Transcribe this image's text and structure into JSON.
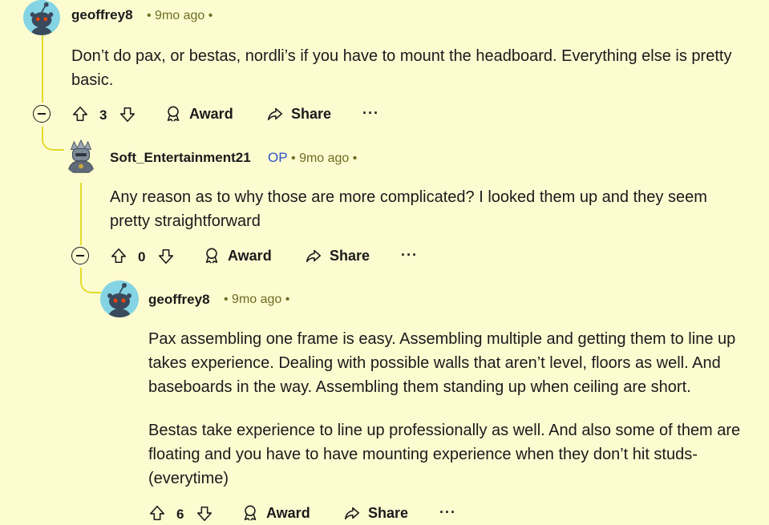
{
  "comments": [
    {
      "author": "geoffrey8",
      "op_badge": "",
      "time": "• 9mo ago •",
      "avatar": "snoo-avatar-icon",
      "paragraphs": [
        "Don’t do pax, or bestas, nordli’s if you have to mount the headboard. Everything else is pretty basic."
      ],
      "votes": "3",
      "award_label": "Award",
      "share_label": "Share",
      "more_label": "···"
    },
    {
      "author": "Soft_Entertainment21",
      "op_badge": "OP",
      "time": "• 9mo ago •",
      "avatar": "robot-avatar-icon",
      "paragraphs": [
        "Any reason as to why those are more complicated? I looked them up and they seem pretty straightforward"
      ],
      "votes": "0",
      "award_label": "Award",
      "share_label": "Share",
      "more_label": "···"
    },
    {
      "author": "geoffrey8",
      "op_badge": "",
      "time": "• 9mo ago •",
      "avatar": "snoo-avatar-icon",
      "paragraphs": [
        "Pax assembling one frame is easy. Assembling multiple and getting them to line up takes experience. Dealing with possible walls that aren’t level, floors as well. And baseboards in the way. Assembling them standing up when ceiling are short.",
        "Bestas take experience to line up professionally as well. And also some of them are floating and you have to have mounting experience when they don’t hit studs- (everytime)"
      ],
      "votes": "6",
      "award_label": "Award",
      "share_label": "Share",
      "more_label": "···"
    }
  ],
  "colors": {
    "background": "#fdfbd0",
    "thread_line": "#e2dc2a",
    "meta_text": "#6b6f22",
    "op_badge": "#2b56c9",
    "avatar_bg": "#84d4e4"
  }
}
